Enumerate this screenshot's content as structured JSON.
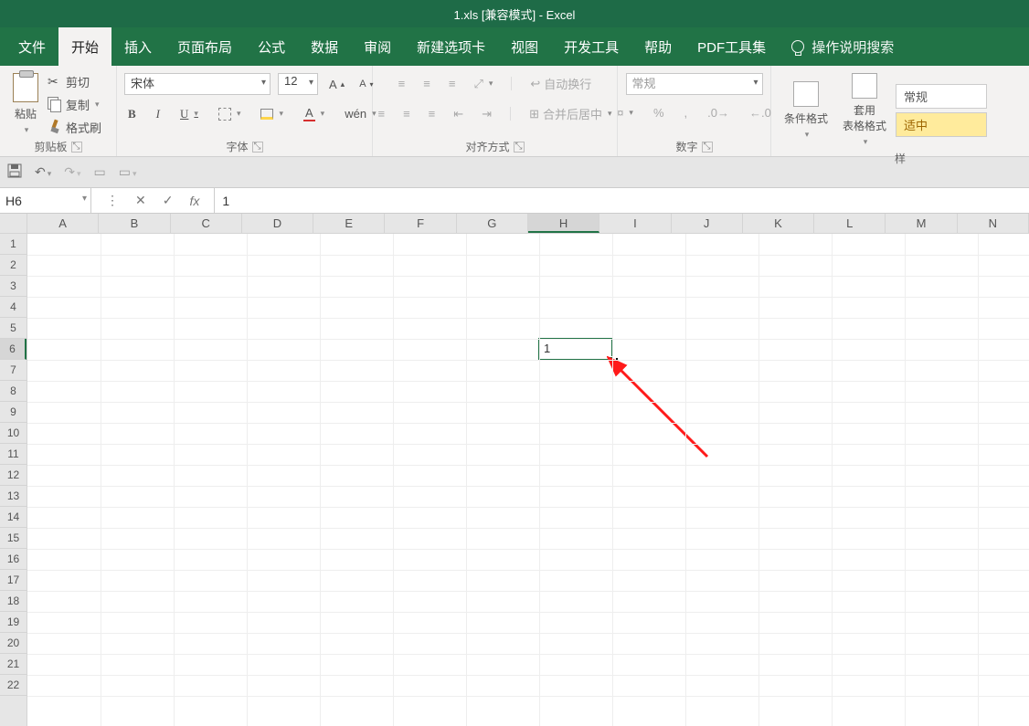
{
  "title": "1.xls  [兼容模式]  -  Excel",
  "tabs": {
    "file": "文件",
    "home": "开始",
    "insert": "插入",
    "layout": "页面布局",
    "formulas": "公式",
    "data": "数据",
    "review": "审阅",
    "newtab": "新建选项卡",
    "view": "视图",
    "dev": "开发工具",
    "help": "帮助",
    "pdf": "PDF工具集",
    "tellme": "操作说明搜索"
  },
  "clipboard": {
    "paste": "粘贴",
    "cut": "剪切",
    "copy": "复制",
    "painter": "格式刷",
    "label": "剪贴板"
  },
  "font": {
    "name": "宋体",
    "size": "12",
    "bold": "B",
    "italic": "I",
    "underline": "U",
    "color_letter": "A",
    "label": "字体"
  },
  "alignment": {
    "wrap": "自动换行",
    "merge": "合并后居中",
    "label": "对齐方式"
  },
  "number": {
    "format": "常规",
    "percent": "%",
    "label": "数字"
  },
  "styles": {
    "cond": "条件格式",
    "table": "套用\n表格格式",
    "normal": "常规",
    "good": "适中"
  },
  "formula_bar": {
    "cell_ref": "H6",
    "fx": "fx",
    "value": "1"
  },
  "grid": {
    "columns": [
      "A",
      "B",
      "C",
      "D",
      "E",
      "F",
      "G",
      "H",
      "I",
      "J",
      "K",
      "L",
      "M",
      "N"
    ],
    "rows": 22,
    "selected_col": "H",
    "selected_row": 6,
    "cell_value": "1"
  }
}
